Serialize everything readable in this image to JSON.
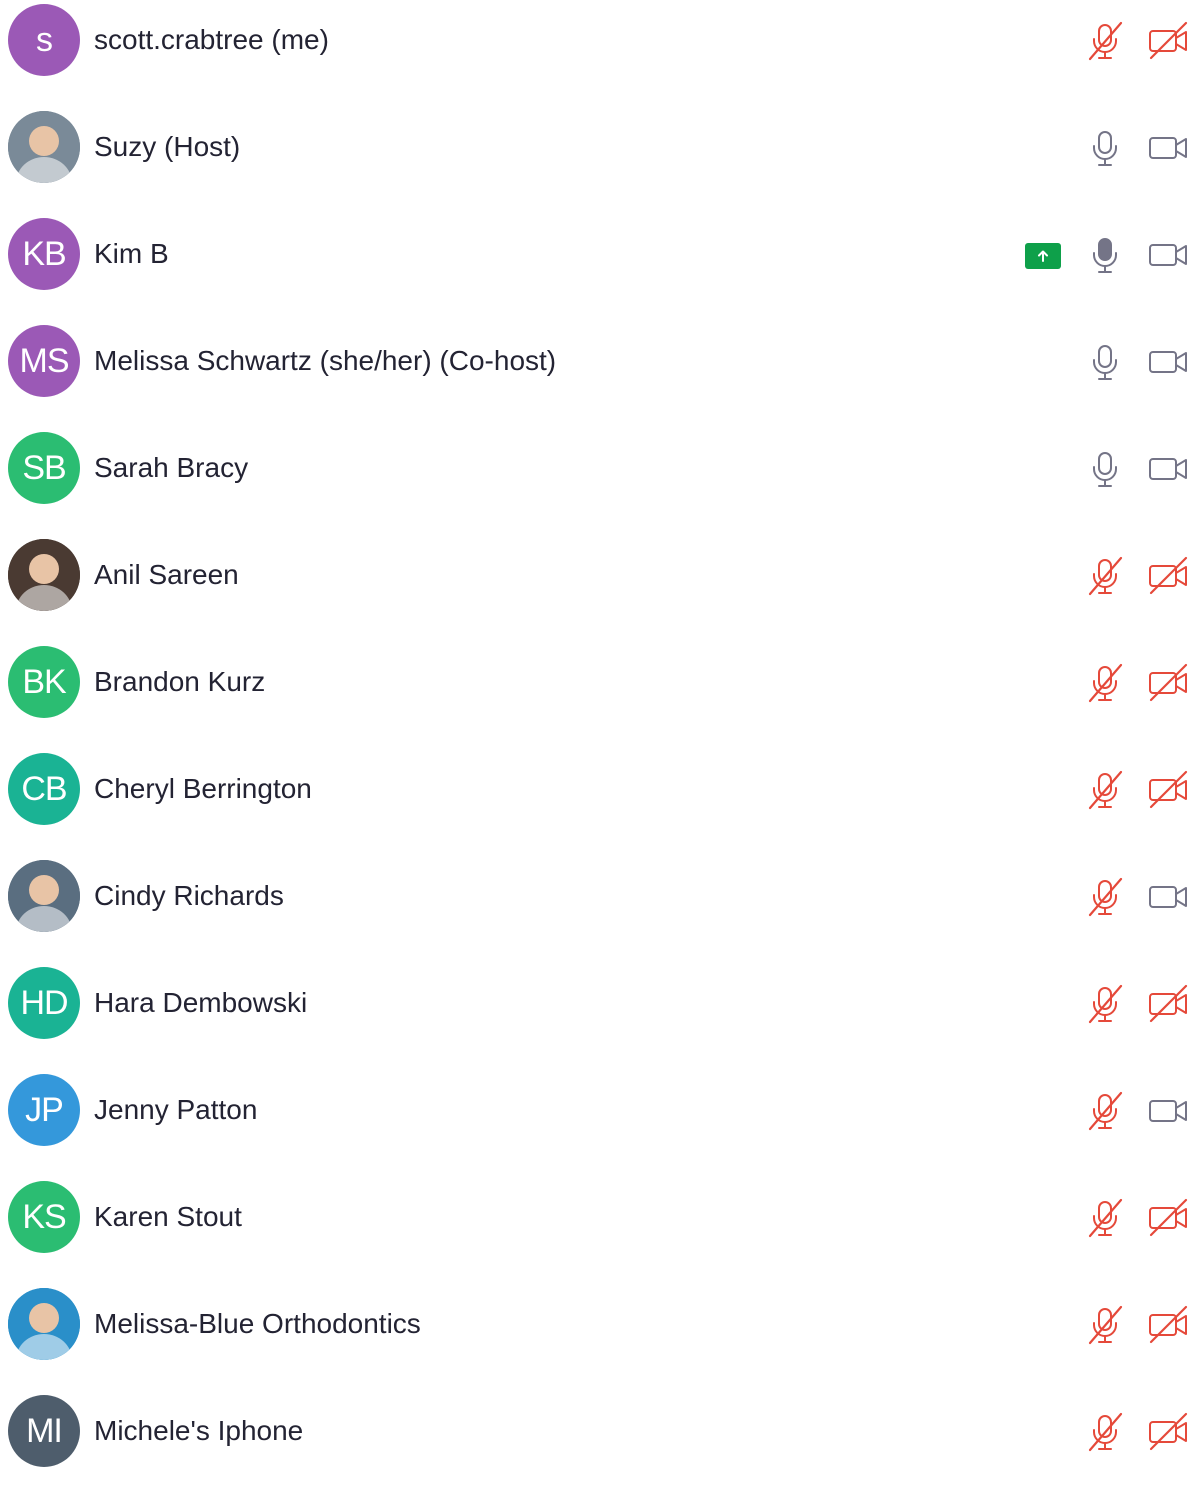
{
  "colors": {
    "muted": "#e5493a",
    "active_icon": "#747487",
    "share_green": "#0ea04a"
  },
  "participants": [
    {
      "name": "scott.crabtree (me)",
      "initials": "s",
      "avatar_color": "#9b59b6",
      "photo": false,
      "mic": "muted",
      "cam": "off",
      "sharing": false
    },
    {
      "name": "Suzy (Host)",
      "initials": "",
      "avatar_color": "#7a8a98",
      "photo": true,
      "mic": "on",
      "cam": "on",
      "sharing": false
    },
    {
      "name": "Kim B",
      "initials": "KB",
      "avatar_color": "#9b59b6",
      "photo": false,
      "mic": "speaking",
      "cam": "on",
      "sharing": true
    },
    {
      "name": "Melissa Schwartz (she/her) (Co-host)",
      "initials": "MS",
      "avatar_color": "#9b59b6",
      "photo": false,
      "mic": "on",
      "cam": "on",
      "sharing": false
    },
    {
      "name": "Sarah Bracy",
      "initials": "SB",
      "avatar_color": "#2bbd72",
      "photo": false,
      "mic": "on",
      "cam": "on",
      "sharing": false
    },
    {
      "name": "Anil Sareen",
      "initials": "",
      "avatar_color": "#4a3a32",
      "photo": true,
      "mic": "muted",
      "cam": "off",
      "sharing": false
    },
    {
      "name": "Brandon Kurz",
      "initials": "BK",
      "avatar_color": "#2bbd72",
      "photo": false,
      "mic": "muted",
      "cam": "off",
      "sharing": false
    },
    {
      "name": "Cheryl Berrington",
      "initials": "CB",
      "avatar_color": "#1ab394",
      "photo": false,
      "mic": "muted",
      "cam": "off",
      "sharing": false
    },
    {
      "name": "Cindy Richards",
      "initials": "",
      "avatar_color": "#5a6e80",
      "photo": true,
      "mic": "muted",
      "cam": "on",
      "sharing": false
    },
    {
      "name": "Hara Dembowski",
      "initials": "HD",
      "avatar_color": "#1ab394",
      "photo": false,
      "mic": "muted",
      "cam": "off",
      "sharing": false
    },
    {
      "name": "Jenny Patton",
      "initials": "JP",
      "avatar_color": "#3498db",
      "photo": false,
      "mic": "muted",
      "cam": "on",
      "sharing": false
    },
    {
      "name": "Karen Stout",
      "initials": "KS",
      "avatar_color": "#2bbd72",
      "photo": false,
      "mic": "muted",
      "cam": "off",
      "sharing": false
    },
    {
      "name": "Melissa-Blue Orthodontics",
      "initials": "",
      "avatar_color": "#2a8fc9",
      "photo": true,
      "mic": "muted",
      "cam": "off",
      "sharing": false
    },
    {
      "name": "Michele's Iphone",
      "initials": "MI",
      "avatar_color": "#4e5d6c",
      "photo": false,
      "mic": "muted",
      "cam": "off",
      "sharing": false
    }
  ]
}
